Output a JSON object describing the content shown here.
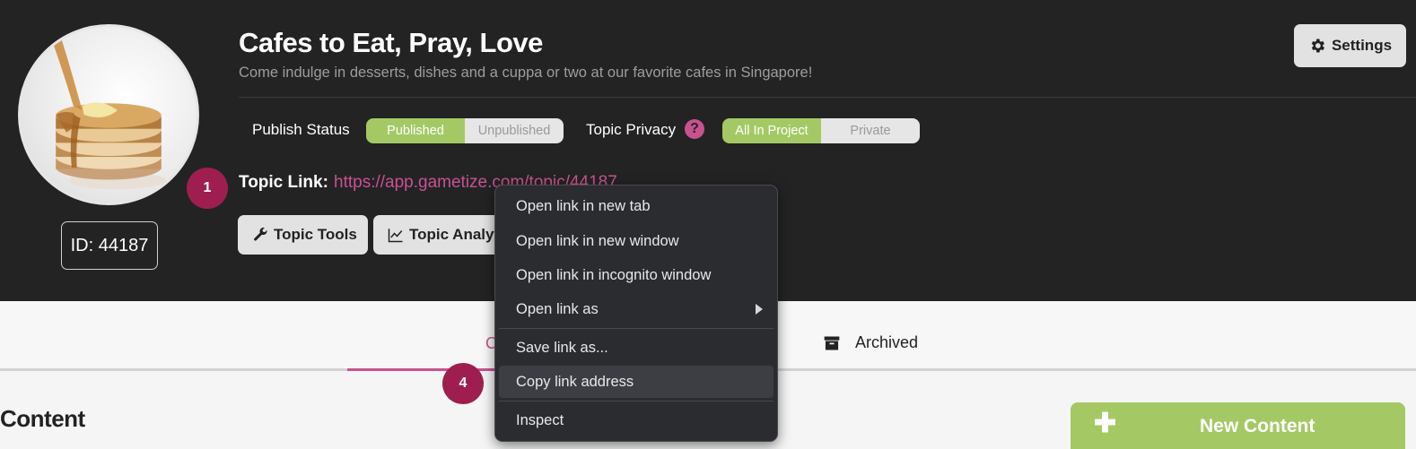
{
  "topic": {
    "title": "Cafes to Eat, Pray, Love",
    "description": "Come indulge in desserts, dishes and a cuppa or two at our favorite cafes in Singapore!",
    "id_label": "ID: 44187",
    "link_label": "Topic Link:",
    "link_url": "https://app.gametize.com/topic/44187"
  },
  "settings": {
    "label": "Settings",
    "icon": "gear-icon"
  },
  "publish_status": {
    "label": "Publish Status",
    "options": [
      "Published",
      "Unpublished"
    ],
    "selected": "Published"
  },
  "topic_privacy": {
    "label": "Topic Privacy",
    "help": "?",
    "options": [
      "All In Project",
      "Private"
    ],
    "selected": "All In Project"
  },
  "tools": {
    "topic_tools": {
      "label": "Topic Tools",
      "icon": "wrench-icon"
    },
    "topic_analytics": {
      "label": "Topic Analytics",
      "icon": "chart-line-icon"
    }
  },
  "badges": [
    "1",
    "4"
  ],
  "tabs": {
    "active_partial": "C",
    "archived": {
      "label": "Archived",
      "icon": "archive-box-icon"
    }
  },
  "content": {
    "heading": "Content",
    "new_button": "New Content"
  },
  "context_menu": {
    "items": [
      "Open link in new tab",
      "Open link in new window",
      "Open link in incognito window",
      "Open link as",
      "Save link as...",
      "Copy link address",
      "Inspect"
    ],
    "highlighted": "Copy link address"
  },
  "colors": {
    "header_bg": "#232323",
    "accent_pink": "#c8528f",
    "accent_green": "#a4c964",
    "badge": "#9e1f4f",
    "menu_bg": "#2b2c30"
  }
}
